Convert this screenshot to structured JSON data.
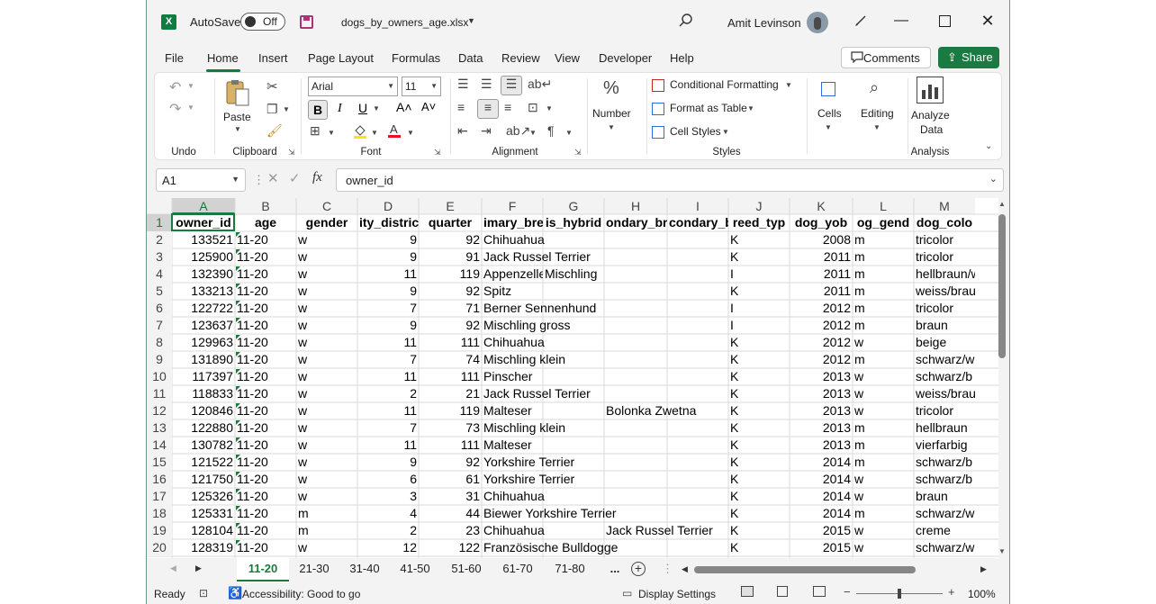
{
  "title_bar": {
    "autosave_label": "AutoSave",
    "autosave_state": "Off",
    "filename": "dogs_by_owners_age.xlsx",
    "user_name": "Amit Levinson"
  },
  "menu_tabs": [
    "File",
    "Home",
    "Insert",
    "Page Layout",
    "Formulas",
    "Data",
    "Review",
    "View",
    "Developer",
    "Help"
  ],
  "buttons": {
    "comments": "Comments",
    "share": "Share"
  },
  "ribbon": {
    "undo_group": "Undo",
    "paste": "Paste",
    "clipboard_group": "Clipboard",
    "font_name": "Arial",
    "font_size": "11",
    "font_group": "Font",
    "alignment_group": "Alignment",
    "number": "Number",
    "conditional_formatting": "Conditional Formatting",
    "format_as_table": "Format as Table",
    "cell_styles": "Cell Styles",
    "styles_group": "Styles",
    "cells": "Cells",
    "editing": "Editing",
    "analyze_data_1": "Analyze",
    "analyze_data_2": "Data",
    "analysis_group": "Analysis"
  },
  "formula_bar": {
    "name_box": "A1",
    "formula": "owner_id"
  },
  "columns": [
    "A",
    "B",
    "C",
    "D",
    "E",
    "F",
    "G",
    "H",
    "I",
    "J",
    "K",
    "L",
    "M"
  ],
  "header_row": [
    "owner_id",
    "age",
    "gender",
    "city_district",
    "quarter",
    "primary_breed",
    "is_hybrid",
    "secondary_breed",
    "secondary_breed",
    "breed_type",
    "dog_yob",
    "dog_gender",
    "dog_color"
  ],
  "header_row_visible": [
    "owner_id",
    "age",
    "gender",
    "ity_distric",
    "quarter",
    "imary_bre",
    "is_hybrid",
    "ondary_br",
    "condary_b",
    "reed_typ",
    "dog_yob",
    "og_gend",
    "dog_colo"
  ],
  "row_numbers": [
    "1",
    "2",
    "3",
    "4",
    "5",
    "6",
    "7",
    "8",
    "9",
    "10",
    "11",
    "12",
    "13",
    "14",
    "15",
    "16",
    "17",
    "18",
    "19",
    "20"
  ],
  "rows": [
    [
      "133521",
      "11-20",
      "w",
      "9",
      "92",
      "Chihuahua",
      "",
      "",
      "",
      "K",
      "2008",
      "m",
      "tricolor"
    ],
    [
      "125900",
      "11-20",
      "w",
      "9",
      "91",
      "Jack Russel Terrier",
      "",
      "",
      "",
      "K",
      "2011",
      "m",
      "tricolor"
    ],
    [
      "132390",
      "11-20",
      "w",
      "11",
      "119",
      "Appenzelle",
      "Mischling",
      "",
      "",
      "I",
      "2011",
      "m",
      "hellbraun/w"
    ],
    [
      "133213",
      "11-20",
      "w",
      "9",
      "92",
      "Spitz",
      "",
      "",
      "",
      "K",
      "2011",
      "m",
      "weiss/brau"
    ],
    [
      "122722",
      "11-20",
      "w",
      "7",
      "71",
      "Berner Sennenhund",
      "",
      "",
      "",
      "I",
      "2012",
      "m",
      "tricolor"
    ],
    [
      "123637",
      "11-20",
      "w",
      "9",
      "92",
      "Mischling gross",
      "",
      "",
      "",
      "I",
      "2012",
      "m",
      "braun"
    ],
    [
      "129963",
      "11-20",
      "w",
      "11",
      "111",
      "Chihuahua",
      "",
      "",
      "",
      "K",
      "2012",
      "w",
      "beige"
    ],
    [
      "131890",
      "11-20",
      "w",
      "7",
      "74",
      "Mischling klein",
      "",
      "",
      "",
      "K",
      "2012",
      "m",
      "schwarz/w"
    ],
    [
      "117397",
      "11-20",
      "w",
      "11",
      "111",
      "Pinscher",
      "",
      "",
      "",
      "K",
      "2013",
      "w",
      "schwarz/b"
    ],
    [
      "118833",
      "11-20",
      "w",
      "2",
      "21",
      "Jack Russel Terrier",
      "",
      "",
      "",
      "K",
      "2013",
      "w",
      "weiss/brau"
    ],
    [
      "120846",
      "11-20",
      "w",
      "11",
      "119",
      "Malteser",
      "",
      "Bolonka Zwetna",
      "",
      "K",
      "2013",
      "w",
      "tricolor"
    ],
    [
      "122880",
      "11-20",
      "w",
      "7",
      "73",
      "Mischling klein",
      "",
      "",
      "",
      "K",
      "2013",
      "m",
      "hellbraun"
    ],
    [
      "130782",
      "11-20",
      "w",
      "11",
      "111",
      "Malteser",
      "",
      "",
      "",
      "K",
      "2013",
      "m",
      "vierfarbig"
    ],
    [
      "121522",
      "11-20",
      "w",
      "9",
      "92",
      "Yorkshire Terrier",
      "",
      "",
      "",
      "K",
      "2014",
      "m",
      "schwarz/b"
    ],
    [
      "121750",
      "11-20",
      "w",
      "6",
      "61",
      "Yorkshire Terrier",
      "",
      "",
      "",
      "K",
      "2014",
      "w",
      "schwarz/b"
    ],
    [
      "125326",
      "11-20",
      "w",
      "3",
      "31",
      "Chihuahua",
      "",
      "",
      "",
      "K",
      "2014",
      "w",
      "braun"
    ],
    [
      "125331",
      "11-20",
      "m",
      "4",
      "44",
      "Biewer Yorkshire Terrier",
      "",
      "",
      "",
      "K",
      "2014",
      "m",
      "schwarz/w"
    ],
    [
      "128104",
      "11-20",
      "m",
      "2",
      "23",
      "Chihuahua",
      "",
      "Jack Russel Terrier",
      "",
      "K",
      "2015",
      "w",
      "creme"
    ],
    [
      "128319",
      "11-20",
      "w",
      "12",
      "122",
      "Französische Bulldogge",
      "",
      "",
      "",
      "K",
      "2015",
      "w",
      "schwarz/w"
    ]
  ],
  "sheet_tabs": [
    "11-20",
    "21-30",
    "31-40",
    "41-50",
    "51-60",
    "61-70",
    "71-80",
    "..."
  ],
  "status": {
    "ready": "Ready",
    "accessibility": "Accessibility: Good to go",
    "display_settings": "Display Settings",
    "zoom": "100%"
  }
}
